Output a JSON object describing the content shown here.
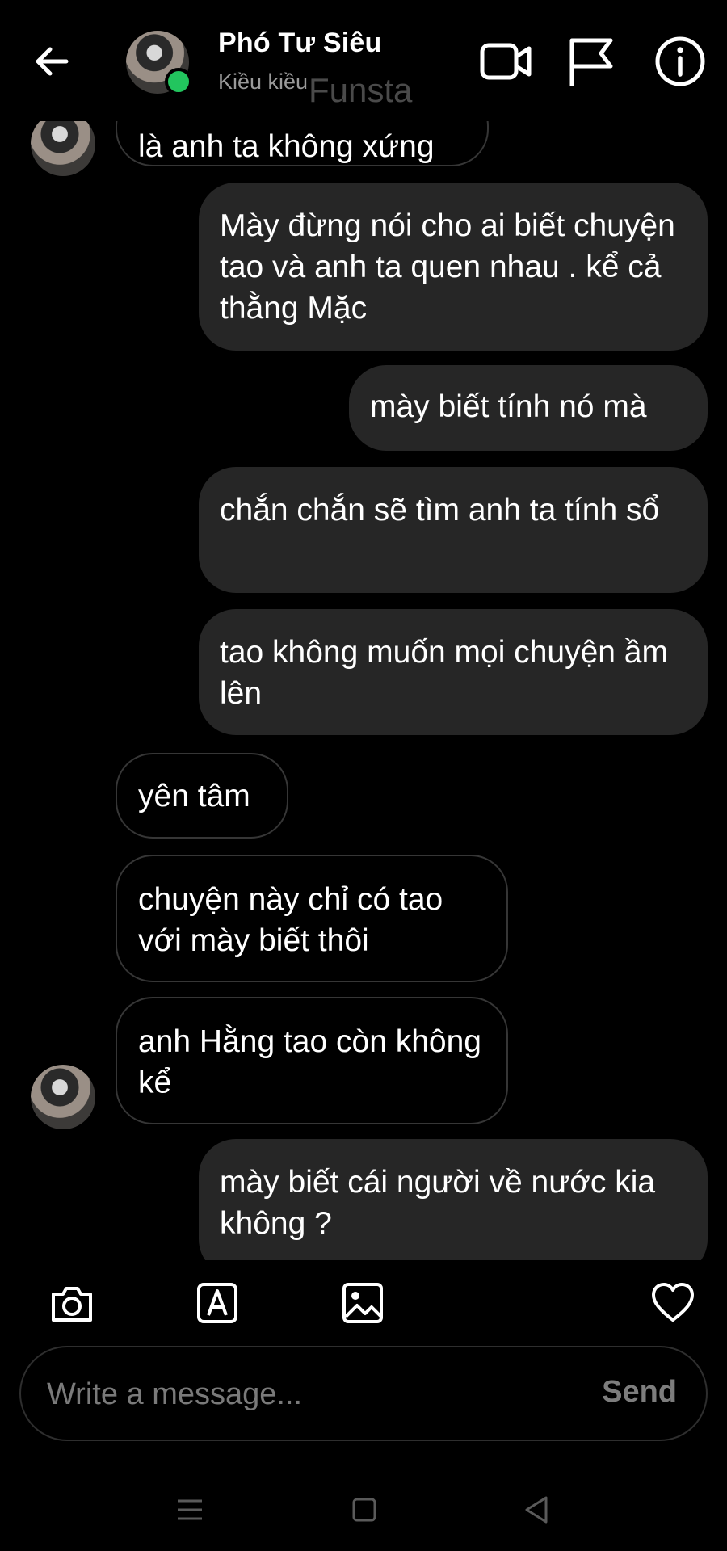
{
  "header": {
    "name": "Phó Tư Siêu",
    "status": "Kiều kiều",
    "watermark": "Funsta",
    "icons": [
      "back-arrow-icon",
      "video-call-icon",
      "flag-icon",
      "info-icon"
    ]
  },
  "messages": [
    {
      "side": "received",
      "text": "là anh ta không xứng"
    },
    {
      "side": "sent",
      "text": "Mày đừng nói cho ai biết chuyện tao và anh ta quen nhau . kể cả thằng Mặc"
    },
    {
      "side": "sent",
      "text": "mày biết tính nó mà"
    },
    {
      "side": "sent",
      "text": "chắn chắn sẽ tìm anh ta tính sổ"
    },
    {
      "side": "sent",
      "text": "tao không muốn mọi chuyện ầm lên"
    },
    {
      "side": "received",
      "text": "yên tâm"
    },
    {
      "side": "received",
      "text": "chuyện này chỉ có tao với mày biết thôi"
    },
    {
      "side": "received",
      "text": "anh Hằng tao còn không kể"
    },
    {
      "side": "sent",
      "text": "mày biết cái người về nước kia không ?"
    }
  ],
  "composer": {
    "placeholder": "Write a message...",
    "send_label": "Send"
  },
  "toolbar": [
    "camera-icon",
    "text-style-icon",
    "gallery-icon",
    "heart-icon"
  ]
}
